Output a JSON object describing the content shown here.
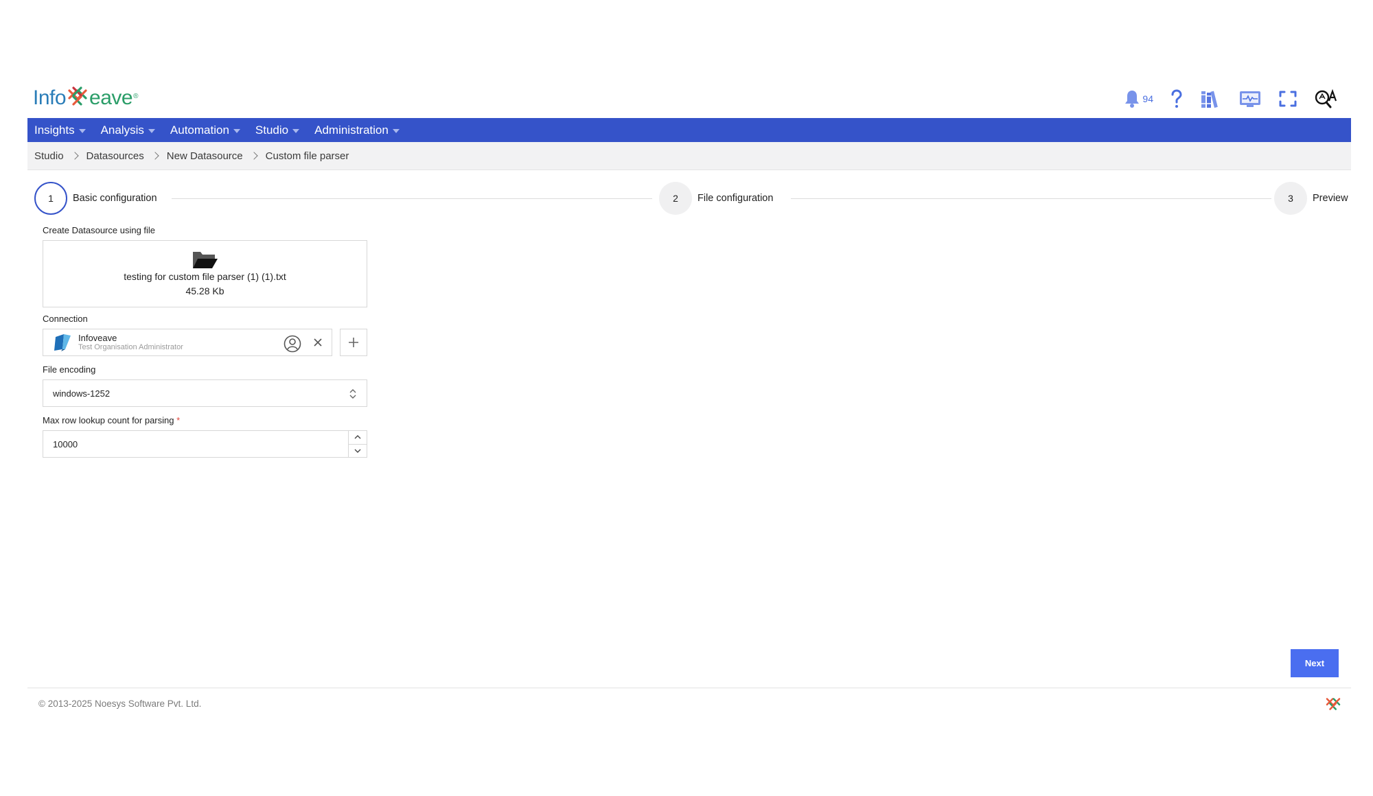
{
  "brand": {
    "name_part1": "Info",
    "name_part2": "eave",
    "reg_mark": "®"
  },
  "header": {
    "notification_count": "94"
  },
  "nav": {
    "items": [
      {
        "label": "Insights"
      },
      {
        "label": "Analysis"
      },
      {
        "label": "Automation"
      },
      {
        "label": "Studio"
      },
      {
        "label": "Administration"
      }
    ]
  },
  "breadcrumb": {
    "items": [
      "Studio",
      "Datasources",
      "New Datasource",
      "Custom file parser"
    ]
  },
  "stepper": {
    "steps": [
      {
        "number": "1",
        "label": "Basic configuration",
        "active": true
      },
      {
        "number": "2",
        "label": "File configuration",
        "active": false
      },
      {
        "number": "3",
        "label": "Preview",
        "active": false
      }
    ]
  },
  "form": {
    "file_label": "Create Datasource using file",
    "file_name": "testing for custom file parser (1) (1).txt",
    "file_size": "45.28 Kb",
    "connection_label": "Connection",
    "connection_name": "Infoveave",
    "connection_sub": "Test Organisation Administrator",
    "encoding_label": "File encoding",
    "encoding_value": "windows-1252",
    "max_row_label": "Max row lookup count for parsing",
    "max_row_required": "*",
    "max_row_value": "10000"
  },
  "actions": {
    "next_label": "Next"
  },
  "footer": {
    "copyright": "© 2013-2025 Noesys Software Pvt. Ltd."
  },
  "colors": {
    "nav_bg": "#3553c9",
    "accent": "#4a6ef0",
    "brand_blue": "#2a7db8",
    "brand_green": "#2a9d68"
  }
}
